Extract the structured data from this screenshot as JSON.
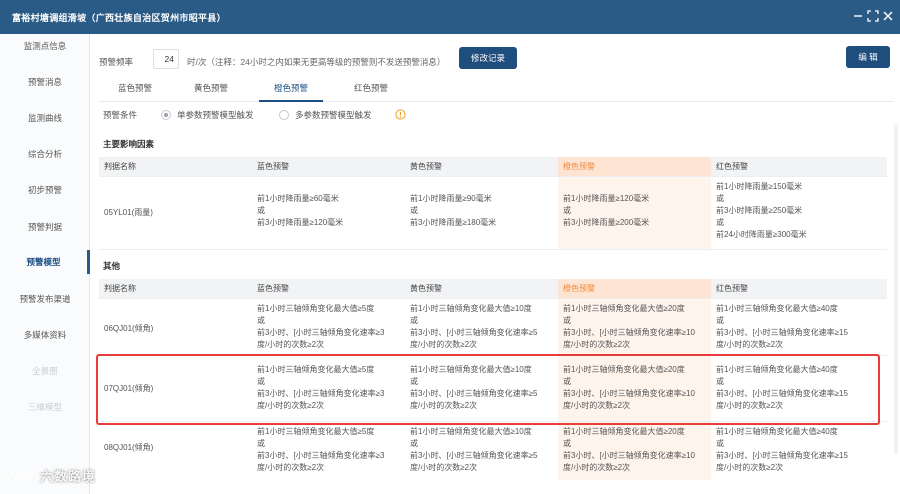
{
  "window": {
    "title": "富裕村塘调组滑坡（广西壮族自治区贺州市昭平县）"
  },
  "sidebar": {
    "items": [
      {
        "label": "监测点信息",
        "state": "normal"
      },
      {
        "label": "预警消息",
        "state": "normal"
      },
      {
        "label": "监测曲线",
        "state": "normal"
      },
      {
        "label": "综合分析",
        "state": "normal"
      },
      {
        "label": "初步预警",
        "state": "normal"
      },
      {
        "label": "预警判据",
        "state": "normal"
      },
      {
        "label": "预警模型",
        "state": "active"
      },
      {
        "label": "预警发布渠道",
        "state": "normal"
      },
      {
        "label": "多媒体资料",
        "state": "normal"
      },
      {
        "label": "全景图",
        "state": "disabled"
      },
      {
        "label": "三维模型",
        "state": "disabled"
      }
    ]
  },
  "toolbar": {
    "freq_label": "预警频率",
    "freq_value": "24",
    "freq_unit": "时/次（注释：24小时之内如果无更高等级的预警则不发送预警消息）",
    "modify_log_label": "修改记录",
    "edit_label": "编 辑"
  },
  "tabs": [
    {
      "label": "蓝色预警",
      "active": false
    },
    {
      "label": "黄色预警",
      "active": false
    },
    {
      "label": "橙色预警",
      "active": true
    },
    {
      "label": "红色预警",
      "active": false
    }
  ],
  "condition": {
    "label": "预警条件",
    "option1": "单参数预警模型触发",
    "option2": "多参数预警模型触发"
  },
  "main_factors": {
    "title": "主要影响因素",
    "headers": [
      "判据名称",
      "蓝色预警",
      "黄色预警",
      "橙色预警",
      "红色预警"
    ],
    "rows": [
      {
        "name": "05YL01(雨量)",
        "blue": [
          "前1小时降雨量≥60毫米",
          "或",
          "前3小时降雨量≥120毫米"
        ],
        "yellow": [
          "前1小时降雨量≥90毫米",
          "或",
          "前3小时降雨量≥180毫米"
        ],
        "orange": [
          "前1小时降雨量≥120毫米",
          "或",
          "前3小时降雨量≥200毫米"
        ],
        "red": [
          "前1小时降雨量≥150毫米",
          "或",
          "前3小时降雨量≥250毫米",
          "或",
          "前24小时降雨量≥300毫米"
        ]
      }
    ]
  },
  "others": {
    "title": "其他",
    "headers": [
      "判据名称",
      "蓝色预警",
      "黄色预警",
      "橙色预警",
      "红色预警"
    ],
    "rows": [
      {
        "name": "06QJ01(倾角)",
        "blue": [
          "前1小时三轴倾角变化最大值≥5度",
          "或",
          "前3小时、[小时三轴倾角变化速率≥3",
          "度/小时的次数≥2次"
        ],
        "yellow": [
          "前1小时三轴倾角变化最大值≥10度",
          "或",
          "前3小时、[小时三轴倾角变化速率≥5",
          "度/小时的次数≥2次"
        ],
        "orange": [
          "前1小时三轴倾角变化最大值≥20度",
          "或",
          "前3小时、[小时三轴倾角变化速率≥10",
          "度/小时的次数≥2次"
        ],
        "red": [
          "前1小时三轴倾角变化最大值≥40度",
          "或",
          "前3小时、[小时三轴倾角变化速率≥15",
          "度/小时的次数≥2次"
        ]
      },
      {
        "name": "07QJ01(倾角)",
        "blue": [
          "前1小时三轴倾角变化最大值≥5度",
          "或",
          "前3小时、[小时三轴倾角变化速率≥3",
          "度/小时的次数≥2次"
        ],
        "yellow": [
          "前1小时三轴倾角变化最大值≥10度",
          "或",
          "前3小时、[小时三轴倾角变化速率≥5",
          "度/小时的次数≥2次"
        ],
        "orange": [
          "前1小时三轴倾角变化最大值≥20度",
          "或",
          "前3小时、[小时三轴倾角变化速率≥10",
          "度/小时的次数≥2次"
        ],
        "red": [
          "前1小时三轴倾角变化最大值≥40度",
          "或",
          "前3小时、[小时三轴倾角变化速率≥15",
          "度/小时的次数≥2次"
        ]
      },
      {
        "name": "08QJ01(倾角)",
        "blue": [
          "前1小时三轴倾角变化最大值≥5度",
          "或",
          "前3小时、[小时三轴倾角变化速率≥3",
          "度/小时的次数≥2次"
        ],
        "yellow": [
          "前1小时三轴倾角变化最大值≥10度",
          "或",
          "前3小时、[小时三轴倾角变化速率≥5",
          "度/小时的次数≥2次"
        ],
        "orange": [
          "前1小时三轴倾角变化最大值≥20度",
          "或",
          "前3小时、[小时三轴倾角变化速率≥10",
          "度/小时的次数≥2次"
        ],
        "red": [
          "前1小时三轴倾角变化最大值≥40度",
          "或",
          "前3小时、[小时三轴倾角变化速率≥15",
          "度/小时的次数≥2次"
        ]
      }
    ]
  },
  "watermark": {
    "text": "六数路境"
  },
  "colors": {
    "titlebar": "#2a5a86",
    "accent": "#1f4d7e",
    "orange_header": "#fde4d3",
    "orange_text": "#f08a3c",
    "highlight_border": "#e83b3b"
  },
  "icons": {
    "window_controls": [
      "minimize-icon",
      "expand-icon",
      "close-icon"
    ],
    "info": "info-circle-icon"
  }
}
